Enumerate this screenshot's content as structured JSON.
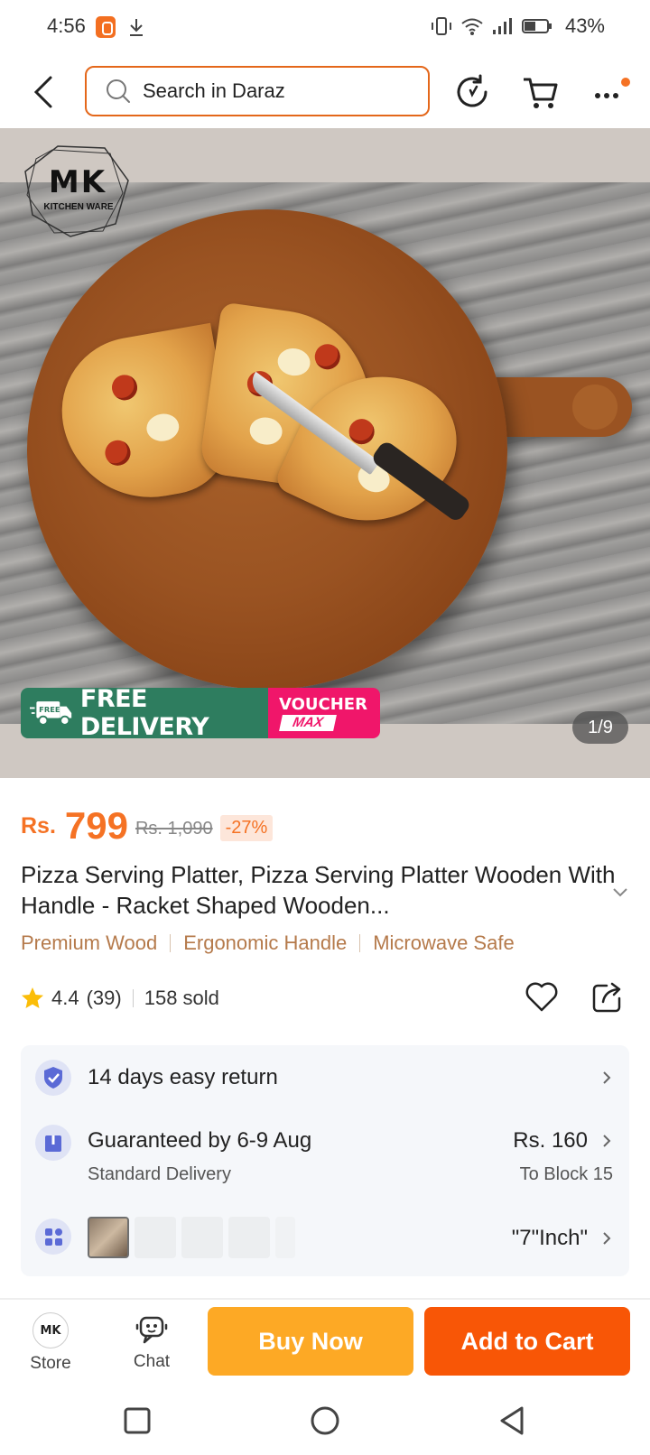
{
  "status_bar": {
    "time": "4:56",
    "battery": "43%",
    "icons": [
      "daraz-app-icon",
      "download-icon",
      "vibrate-icon",
      "wifi-icon",
      "signal-icon",
      "battery-icon"
    ]
  },
  "top_bar": {
    "back_icon": "chevron-left-icon",
    "search_placeholder": "Search in Daraz",
    "search_icon": "search-icon",
    "refresh_icon": "refresh-icon",
    "cart_icon": "cart-icon",
    "more_icon": "more-horizontal-icon",
    "accent_color": "#f57224"
  },
  "gallery": {
    "brand_logo_text": "MK",
    "brand_logo_sub": "KITCHEN WARE",
    "badge_delivery": "FREE DELIVERY",
    "badge_delivery_small": "FREE",
    "badge_voucher_top": "VOUCHER",
    "badge_voucher_bottom": "MAX",
    "counter": "1/9"
  },
  "product": {
    "currency": "Rs.",
    "price": "799",
    "old_price": "Rs. 1,090",
    "discount": "-27%",
    "title": "Pizza Serving Platter, Pizza Serving Platter Wooden With Handle - Racket Shaped Wooden...",
    "features": [
      "Premium Wood",
      "Ergonomic Handle",
      "Microwave Safe"
    ],
    "rating": "4.4",
    "rating_count": "(39)",
    "sold": "158 sold"
  },
  "info": {
    "return": "14 days easy return",
    "delivery_main": "Guaranteed by 6-9 Aug",
    "delivery_sub": "Standard Delivery",
    "delivery_fee": "Rs. 160",
    "delivery_location": "To Block 15",
    "variant": "\"7\"Inch\""
  },
  "bottom_bar": {
    "store_label": "Store",
    "store_avatar": "MK",
    "chat_label": "Chat",
    "buy_now": "Buy Now",
    "add_to_cart": "Add to Cart",
    "buy_now_color": "#fda925",
    "add_to_cart_color": "#f85606"
  },
  "nav_bar": {
    "icons": [
      "recents-square-icon",
      "home-circle-icon",
      "back-triangle-icon"
    ]
  }
}
